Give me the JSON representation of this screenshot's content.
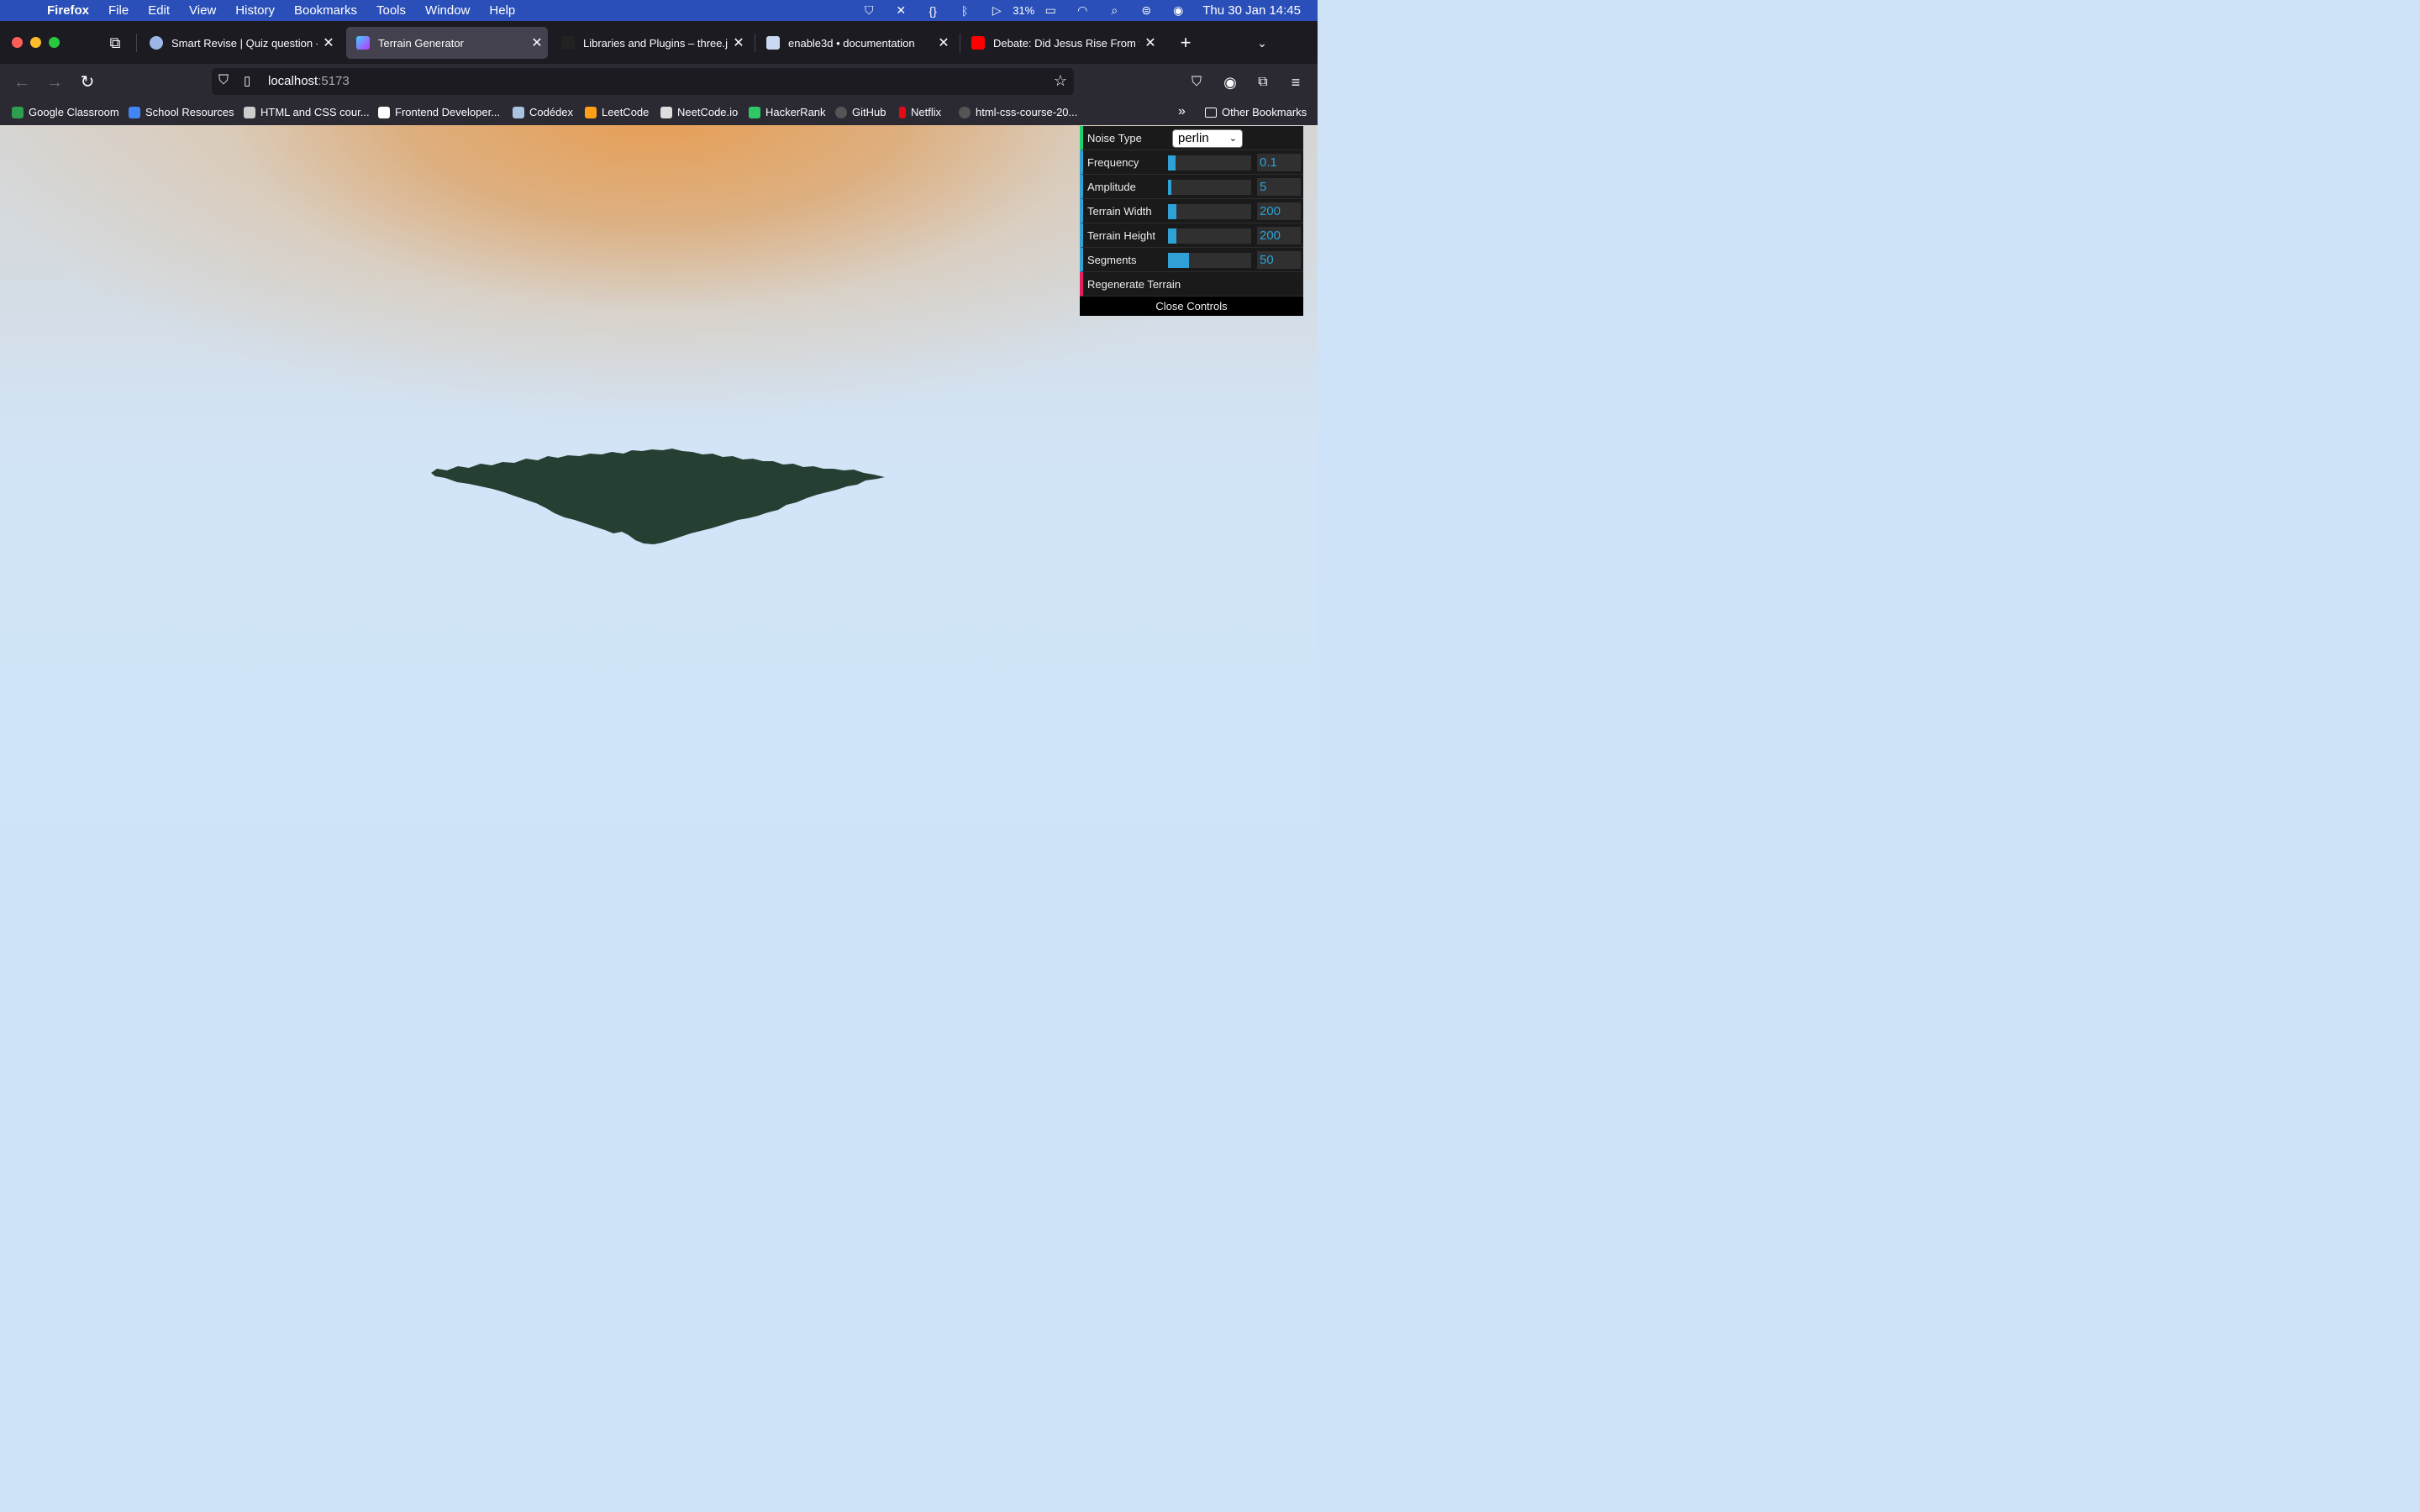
{
  "menubar": {
    "app_name": "Firefox",
    "items": [
      "File",
      "Edit",
      "View",
      "History",
      "Bookmarks",
      "Tools",
      "Window",
      "Help"
    ],
    "battery": "31%",
    "clock": "Thu 30 Jan  14:45"
  },
  "tabs": [
    {
      "title": "Smart Revise | Quiz question - H",
      "active": false,
      "favicon_color": "#9db8e8"
    },
    {
      "title": "Terrain Generator",
      "active": true,
      "favicon_color": "#bd34fe"
    },
    {
      "title": "Libraries and Plugins – three.js f",
      "active": false,
      "favicon_color": "#222222"
    },
    {
      "title": "enable3d • documentation",
      "active": false,
      "favicon_color": "#c9d9f2"
    },
    {
      "title": "Debate: Did Jesus Rise From the",
      "active": false,
      "favicon_color": "#ff0000"
    }
  ],
  "url": {
    "host": "localhost",
    "port": ":5173"
  },
  "bookmarks": [
    {
      "label": "Google Classroom",
      "color": "#2e9e4f"
    },
    {
      "label": "School Resources",
      "color": "#4285f4"
    },
    {
      "label": "HTML and CSS cour...",
      "color": "#cccccc"
    },
    {
      "label": "Frontend Developer...",
      "color": "#ffffff"
    },
    {
      "label": "Codédex",
      "color": "#aac4e0"
    },
    {
      "label": "LeetCode",
      "color": "#ffa116"
    },
    {
      "label": "NeetCode.io",
      "color": "#dddddd"
    },
    {
      "label": "HackerRank",
      "color": "#2ec866"
    },
    {
      "label": "GitHub",
      "color": "#555555"
    },
    {
      "label": "Netflix",
      "color": "#e50914"
    },
    {
      "label": "html-css-course-20...",
      "color": "#555555"
    }
  ],
  "other_bookmarks": "Other Bookmarks",
  "controls": {
    "noise_type_label": "Noise Type",
    "noise_type_value": "perlin",
    "frequency_label": "Frequency",
    "frequency_value": "0.1",
    "frequency_fill": 0.09,
    "amplitude_label": "Amplitude",
    "amplitude_value": "5",
    "amplitude_fill": 0.04,
    "width_label": "Terrain Width",
    "width_value": "200",
    "width_fill": 0.1,
    "height_label": "Terrain Height",
    "height_value": "200",
    "height_fill": 0.1,
    "segments_label": "Segments",
    "segments_value": "50",
    "segments_fill": 0.25,
    "regenerate_label": "Regenerate Terrain",
    "close_label": "Close Controls"
  },
  "colors": {
    "sky_top": "#e8a258",
    "sky_bottom": "#d2e5f8",
    "terrain": "#253f32",
    "slider": "#2fa1d6"
  }
}
